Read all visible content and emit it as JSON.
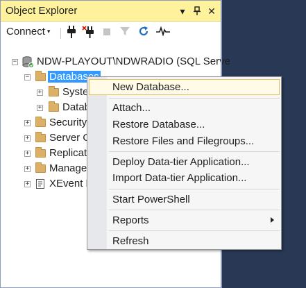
{
  "explorer": {
    "title": "Object Explorer",
    "title_buttons": {
      "dropdown": "▾",
      "pin": "⊥",
      "close": "✕"
    },
    "toolbar": {
      "connect_label": "Connect",
      "connect_caret": "▾",
      "icons": [
        "connect-plug-icon",
        "disconnect-plug-icon",
        "stop-icon",
        "filter-icon",
        "refresh-icon",
        "activity-monitor-icon"
      ]
    },
    "tree": {
      "server": "NDW-PLAYOUT\\NDWRADIO (SQL Serve",
      "databases": "Databases",
      "system_db": "System",
      "db_snapshots": "Datab",
      "security": "Security",
      "server_objects": "Server O",
      "replication": "Replicat",
      "management": "Manage",
      "xevent": "XEvent P",
      "expand_sign": "+",
      "collapse_sign": "−"
    }
  },
  "context_menu": {
    "new_database": "New Database...",
    "attach": "Attach...",
    "restore_database": "Restore Database...",
    "restore_files": "Restore Files and Filegroups...",
    "deploy_data_tier": "Deploy Data-tier Application...",
    "import_data_tier": "Import Data-tier Application...",
    "start_powershell": "Start PowerShell",
    "reports": "Reports",
    "refresh": "Refresh"
  },
  "colors": {
    "title_bar": "#fff29d",
    "selection": "#3399ff",
    "hot_item_border": "#e5c365",
    "background": "#293955"
  }
}
